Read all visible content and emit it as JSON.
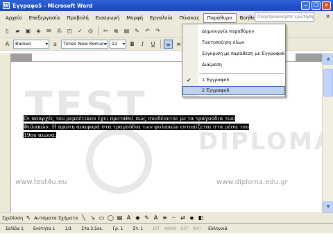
{
  "window": {
    "title": "Έγγραφο5 - Microsoft Word",
    "doc_icon": "W"
  },
  "menu": {
    "items": [
      "Αρχείο",
      "Επεξεργασία",
      "Προβολή",
      "Εισαγωγή",
      "Μορφή",
      "Εργαλεία",
      "Πίνακας",
      "Παράθυρο",
      "Βοήθεια"
    ],
    "help_placeholder": "Πληκτρολογήστε ερώτηση"
  },
  "formatting": {
    "style": "Βασικό",
    "font": "Times New Roman",
    "size": "12"
  },
  "window_menu": {
    "items": [
      "Δημιουργία παραθύρου",
      "Τακτοποίηση όλων",
      "Σύγκριση με παράθεση με Έγγραφο6",
      "Διαίρεση"
    ],
    "open_windows": [
      "1 Έγγραφο5",
      "2 Έγγραφο6"
    ],
    "checked_index": 0,
    "highlighted_index": 1
  },
  "document": {
    "selected_text_lines": [
      "Οι απαρχές του ρεμπέτικου έχει προταθεί πώς συνδέονται με τα τραγούδια των",
      "Φυλακών. Η πρώτη αναφορά στα τραγούδια των φυλακών εντοπίζεται στα μέσα του",
      "19ου αιώνα."
    ]
  },
  "watermark": {
    "left_word": "TEST",
    "right_word": "DIPLOMA",
    "badge": "4U",
    "left_url": "www.test4u.eu",
    "right_url": "www.diploma.edu.gr"
  },
  "drawing_toolbar": {
    "draw_label": "Σχεδίαση",
    "autoshapes_label": "Αυτόματα Σχήματα"
  },
  "status": {
    "page": "Σελίδα 1",
    "section": "Ενότητα 1",
    "page_of": "1/1",
    "position": "Στα 2,5εκ.",
    "line": "Γρ. 1",
    "column": "Στ. 1",
    "modes": [
      "ΕΓΓ",
      "ΑΝΑΘ",
      "ΕΚΤ",
      "ΑΝΤ"
    ],
    "language": "Ελληνικά"
  },
  "colors": {
    "titlebar": "#1a45b8",
    "highlight": "#c1d2ee",
    "selection": "#000000"
  }
}
